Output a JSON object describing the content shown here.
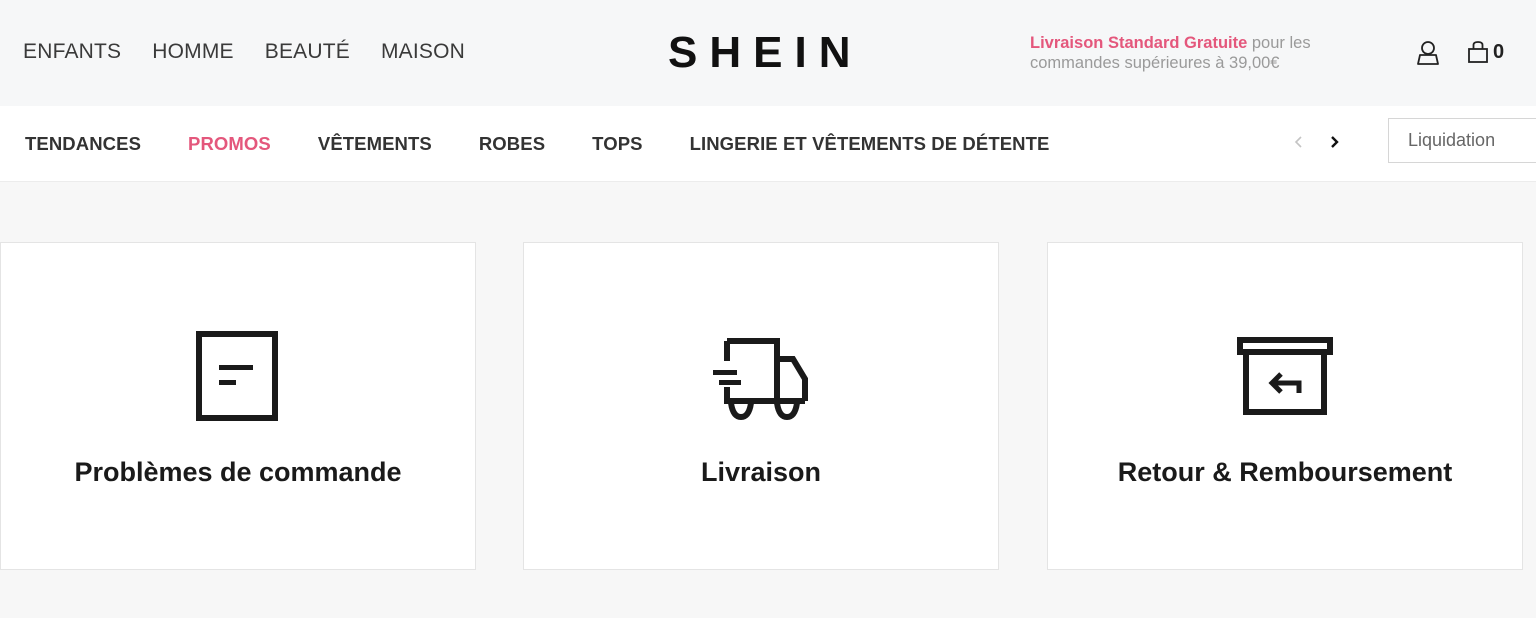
{
  "header": {
    "links": [
      "ENFANTS",
      "HOMME",
      "BEAUTÉ",
      "MAISON"
    ],
    "logo": "SHEIN",
    "promo_highlight": "Livraison Standard Gratuite",
    "promo_rest": " pour les commandes supérieures à 39,00€",
    "bag_count": "0",
    "user_icon": "user-icon",
    "bag_icon": "shopping-bag-icon"
  },
  "nav": {
    "items": [
      "TENDANCES",
      "PROMOS",
      "VÊTEMENTS",
      "ROBES",
      "TOPS",
      "LINGERIE ET VÊTEMENTS DE DÉTENTE"
    ],
    "search_placeholder": "Liquidation"
  },
  "cards": [
    {
      "title": "Problèmes de commande",
      "icon": "order-document-icon"
    },
    {
      "title": "Livraison",
      "icon": "delivery-truck-icon"
    },
    {
      "title": "Retour & Remboursement",
      "icon": "return-box-icon"
    }
  ],
  "colors": {
    "accent": "#e4577c",
    "header_bg": "#f6f7f8",
    "page_bg": "#f7f7f7"
  }
}
